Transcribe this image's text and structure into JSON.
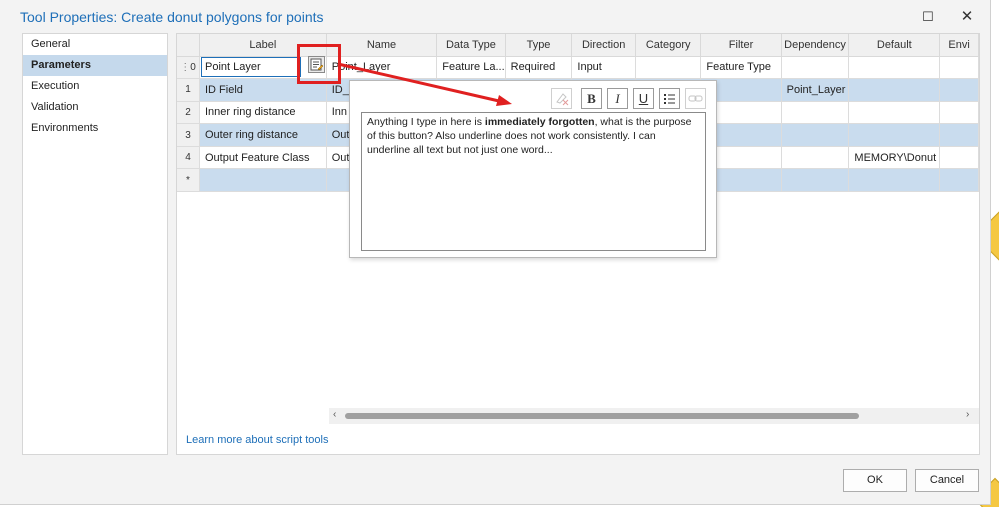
{
  "window": {
    "title": "Tool Properties: Create donut polygons for points",
    "maximize_icon": "maximize-icon",
    "close_icon": "close-icon"
  },
  "sidebar": {
    "items": [
      {
        "label": "General",
        "active": false
      },
      {
        "label": "Parameters",
        "active": true
      },
      {
        "label": "Execution",
        "active": false
      },
      {
        "label": "Validation",
        "active": false
      },
      {
        "label": "Environments",
        "active": false
      }
    ]
  },
  "grid": {
    "columns": [
      "",
      "Label",
      "Name",
      "Data Type",
      "Type",
      "Direction",
      "Category",
      "Filter",
      "Dependency",
      "Default",
      "Envi"
    ],
    "rows": [
      {
        "num": "0",
        "label": "Point Layer",
        "name": "Point_Layer",
        "data_type": "Feature La...",
        "type": "Required",
        "direction": "Input",
        "category": "",
        "filter": "Feature Type",
        "dependency": "",
        "default": ""
      },
      {
        "num": "1",
        "label": "ID Field",
        "name": "ID_",
        "data_type": "",
        "type": "",
        "direction": "",
        "category": "",
        "filter": "",
        "dependency": "Point_Layer",
        "default": ""
      },
      {
        "num": "2",
        "label": "Inner ring distance",
        "name": "Inn",
        "data_type": "",
        "type": "",
        "direction": "",
        "category": "",
        "filter": "",
        "dependency": "",
        "default": ""
      },
      {
        "num": "3",
        "label": "Outer ring distance",
        "name": "Out",
        "data_type": "",
        "type": "",
        "direction": "",
        "category": "",
        "filter": "",
        "dependency": "",
        "default": ""
      },
      {
        "num": "4",
        "label": "Output Feature Class",
        "name": "Out",
        "data_type": "",
        "type": "",
        "direction": "",
        "category": "",
        "filter": "",
        "dependency": "",
        "default": "MEMORY\\Donut"
      },
      {
        "num": "*",
        "label": "",
        "name": "",
        "data_type": "",
        "type": "",
        "direction": "",
        "category": "",
        "filter": "",
        "dependency": "",
        "default": ""
      }
    ]
  },
  "note_popup": {
    "toolbar": {
      "clear_icon": "clear-formatting-icon",
      "bold": "B",
      "italic": "I",
      "underline": "U",
      "list_icon": "bulleted-list-icon",
      "link_icon": "hyperlink-icon"
    },
    "text_before": "Anything I type in here is ",
    "text_bold": "immediately forgotten",
    "text_after": ", what is the purpose of this button? Also underline does not work consistently. I can underline all text but not just one word..."
  },
  "annotation": {
    "highlight_color": "#e02020"
  },
  "footer": {
    "learn_link": "Learn more about script tools",
    "ok": "OK",
    "cancel": "Cancel"
  },
  "colors": {
    "accent": "#1e6fb8",
    "selected_row": "#c9dcee"
  }
}
